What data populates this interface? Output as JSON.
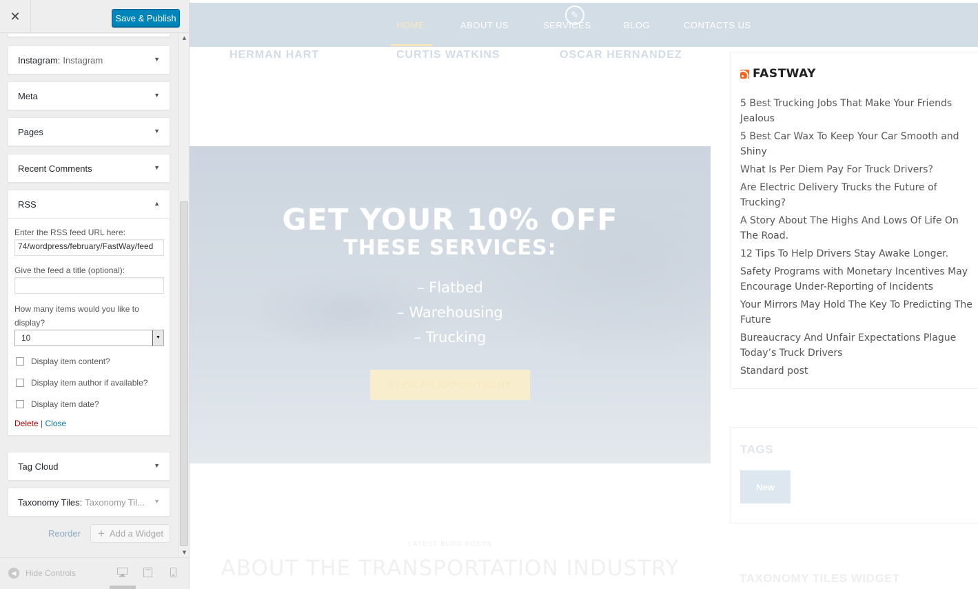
{
  "sidebar": {
    "close_label": "✕",
    "publish_label": "Save & Publish",
    "widgets": {
      "instagram": {
        "title": "Instagram:",
        "subtitle": "Instagram"
      },
      "meta": {
        "title": "Meta"
      },
      "pages": {
        "title": "Pages"
      },
      "recent_comments": {
        "title": "Recent Comments"
      },
      "rss": {
        "title": "RSS",
        "url_label": "Enter the RSS feed URL here:",
        "url_value": "74/wordpress/february/FastWay/feed",
        "title_label": "Give the feed a title (optional):",
        "title_value": "",
        "items_label": "How many items would you like to display?",
        "items_value": "10",
        "opt_content": "Display item content?",
        "opt_author": "Display item author if available?",
        "opt_date": "Display item date?",
        "delete_label": "Delete",
        "separator": "|",
        "close_label": "Close"
      },
      "tag_cloud": {
        "title": "Tag Cloud"
      },
      "taxonomy_tiles": {
        "title": "Taxonomy Tiles:",
        "subtitle": "Taxonomy Til..."
      }
    },
    "reorder_label": "Reorder",
    "add_widget_label": "Add a Widget",
    "hide_controls_label": "Hide Controls"
  },
  "preview": {
    "nav": [
      "HOME",
      "ABOUT US",
      "SERVICES",
      "BLOG",
      "CONTACTS US"
    ],
    "team": [
      "HERMAN HART",
      "CURTIS WATKINS",
      "OSCAR HERNANDEZ"
    ],
    "promo": {
      "title_line1": "GET YOUR 10% OFF",
      "title_line2": "THESE SERVICES:",
      "items": [
        "– Flatbed",
        "– Warehousing",
        "– Trucking"
      ],
      "button_label": "BOOK AN APPOINTMENT"
    },
    "rss_widget": {
      "title": "FASTWAY",
      "posts": [
        "5 Best Trucking Jobs That Make Your Friends Jealous",
        "5 Best Car Wax To Keep Your Car Smooth and Shiny",
        "What Is Per Diem Pay For Truck Drivers?",
        "Are Electric Delivery Trucks the Future of Trucking?",
        "A Story About The Highs And Lows Of Life On The Road.",
        "12 Tips To Help Drivers Stay Awake Longer.",
        "Safety Programs with Monetary Incentives May Encourage Under-Reporting of Incidents",
        "Your Mirrors May Hold The Key To Predicting The Future",
        "Bureaucracy And Unfair Expectations Plague Today’s Truck Drivers",
        "Standard post"
      ]
    },
    "tags_widget": {
      "title": "TAGS",
      "tags": [
        "New"
      ]
    },
    "blog_subtitle": "LATEST BLOG POSTS",
    "blog_title": "ABOUT THE TRANSPORTATION INDUSTRY",
    "taxonomy_widget_title": "TAXONOMY TILES WIDGET"
  },
  "colors": {
    "publish_button": "#0085ba",
    "nav_background": "#d3dde6",
    "nav_active": "#f7e8c0",
    "delete_link": "#aa0000",
    "close_link": "#0073aa",
    "rss_icon": "#f26522"
  },
  "icons": {
    "close": "close-icon",
    "edit": "pencil-icon",
    "rss": "rss-feed-icon",
    "hide_controls": "collapse-icon",
    "desktop": "desktop-icon",
    "tablet": "tablet-icon",
    "mobile": "mobile-icon",
    "add": "plus-icon"
  }
}
